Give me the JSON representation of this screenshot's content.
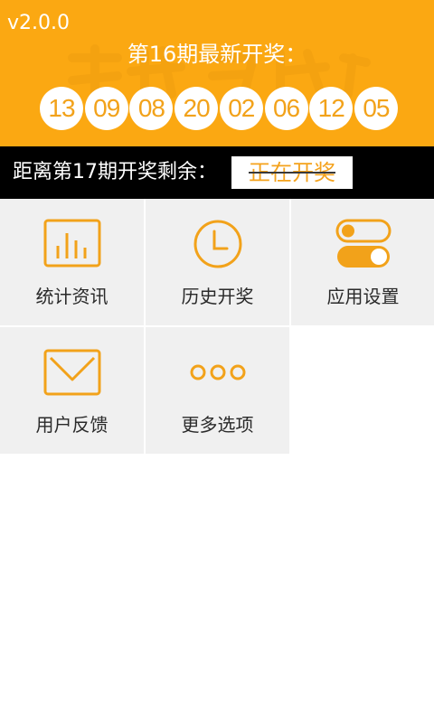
{
  "header": {
    "version": "v2.0.0",
    "draw_title": "第16期最新开奖："
  },
  "winning_numbers": [
    "13",
    "09",
    "08",
    "20",
    "02",
    "06",
    "12",
    "05"
  ],
  "countdown": {
    "label": "距离第17期开奖剩余：",
    "status": "正在开奖"
  },
  "menu": [
    {
      "label": "统计资讯",
      "icon": "bar-chart-icon"
    },
    {
      "label": "历史开奖",
      "icon": "clock-icon"
    },
    {
      "label": "应用设置",
      "icon": "toggle-switch-icon"
    },
    {
      "label": "用户反馈",
      "icon": "envelope-icon"
    },
    {
      "label": "更多选项",
      "icon": "more-dots-icon"
    }
  ],
  "colors": {
    "accent": "#fba812",
    "icon": "#f2a21a",
    "tile_background": "#f0f0f0",
    "countdown_background": "#000000"
  }
}
